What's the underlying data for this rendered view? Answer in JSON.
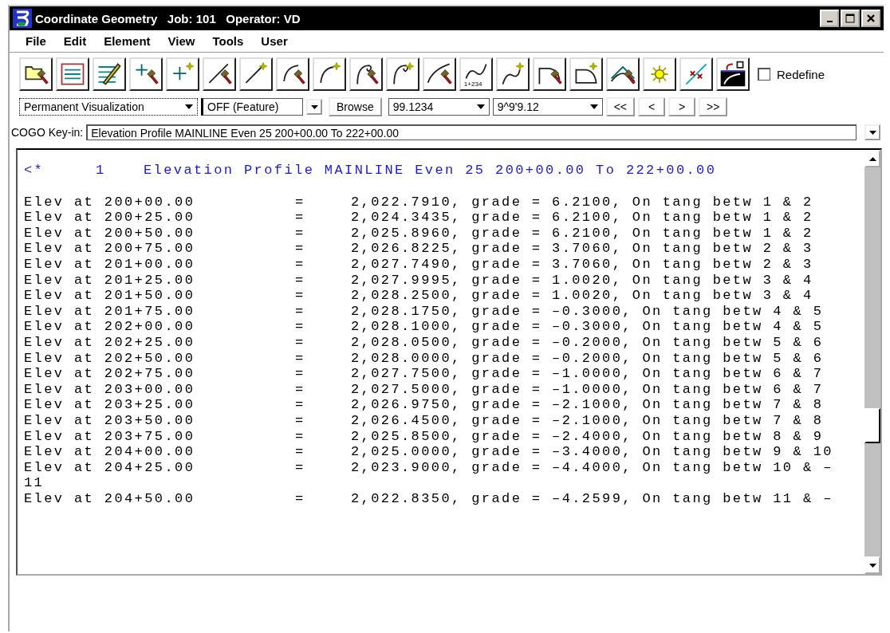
{
  "window": {
    "title": "Coordinate Geometry   Job: 101   Operator: VD"
  },
  "menu": [
    "File",
    "Edit",
    "Element",
    "View",
    "Tools",
    "User"
  ],
  "toolbar": {
    "icon_caption": "1+234",
    "redefine": {
      "label": "Redefine",
      "checked": false
    }
  },
  "controls": {
    "visualization": "Permanent Visualization",
    "feature": "OFF (Feature)",
    "browse": "Browse",
    "distance": "99.1234",
    "angle": "9^9'9.12",
    "nav": [
      "<<",
      "<",
      ">",
      ">>"
    ]
  },
  "keyin": {
    "label": "COGO Key-in:",
    "value": "Elevation Profile MAINLINE Even 25 200+00.00 To 222+00.00"
  },
  "output": {
    "header": {
      "marker": "<*",
      "number": "1",
      "text": "Elevation Profile MAINLINE Even 25 200+00.00 To 222+00.00"
    },
    "lines": [
      {
        "kind": "row",
        "station": "Elev at 200+00.00",
        "eq": "=",
        "result": "2,022.7910, grade = 6.2100, On tang betw 1 & 2"
      },
      {
        "kind": "row",
        "station": "Elev at 200+25.00",
        "eq": "=",
        "result": "2,024.3435, grade = 6.2100, On tang betw 1 & 2"
      },
      {
        "kind": "row",
        "station": "Elev at 200+50.00",
        "eq": "=",
        "result": "2,025.8960, grade = 6.2100, On tang betw 1 & 2"
      },
      {
        "kind": "row",
        "station": "Elev at 200+75.00",
        "eq": "=",
        "result": "2,026.8225, grade = 3.7060, On tang betw 2 & 3"
      },
      {
        "kind": "row",
        "station": "Elev at 201+00.00",
        "eq": "=",
        "result": "2,027.7490, grade = 3.7060, On tang betw 2 & 3"
      },
      {
        "kind": "row",
        "station": "Elev at 201+25.00",
        "eq": "=",
        "result": "2,027.9995, grade = 1.0020, On tang betw 3 & 4"
      },
      {
        "kind": "row",
        "station": "Elev at 201+50.00",
        "eq": "=",
        "result": "2,028.2500, grade = 1.0020, On tang betw 3 & 4"
      },
      {
        "kind": "row",
        "station": "Elev at 201+75.00",
        "eq": "=",
        "result": "2,028.1750, grade = –0.3000, On tang betw 4 & 5"
      },
      {
        "kind": "row",
        "station": "Elev at 202+00.00",
        "eq": "=",
        "result": "2,028.1000, grade = –0.3000, On tang betw 4 & 5"
      },
      {
        "kind": "row",
        "station": "Elev at 202+25.00",
        "eq": "=",
        "result": "2,028.0500, grade = –0.2000, On tang betw 5 & 6"
      },
      {
        "kind": "row",
        "station": "Elev at 202+50.00",
        "eq": "=",
        "result": "2,028.0000, grade = –0.2000, On tang betw 5 & 6"
      },
      {
        "kind": "row",
        "station": "Elev at 202+75.00",
        "eq": "=",
        "result": "2,027.7500, grade = –1.0000, On tang betw 6 & 7"
      },
      {
        "kind": "row",
        "station": "Elev at 203+00.00",
        "eq": "=",
        "result": "2,027.5000, grade = –1.0000, On tang betw 6 & 7"
      },
      {
        "kind": "row",
        "station": "Elev at 203+25.00",
        "eq": "=",
        "result": "2,026.9750, grade = –2.1000, On tang betw 7 & 8"
      },
      {
        "kind": "row",
        "station": "Elev at 203+50.00",
        "eq": "=",
        "result": "2,026.4500, grade = –2.1000, On tang betw 7 & 8"
      },
      {
        "kind": "row",
        "station": "Elev at 203+75.00",
        "eq": "=",
        "result": "2,025.8500, grade = –2.4000, On tang betw 8 & 9"
      },
      {
        "kind": "row",
        "station": "Elev at 204+00.00",
        "eq": "=",
        "result": "2,025.0000, grade = –3.4000, On tang betw 9 & 10"
      },
      {
        "kind": "row",
        "station": "Elev at 204+25.00",
        "eq": "=",
        "result": "2,023.9000, grade = –4.4000, On tang betw 10 & –"
      },
      {
        "kind": "wrap",
        "text": "11"
      },
      {
        "kind": "row",
        "station": "Elev at 204+50.00",
        "eq": "=",
        "result": "2,022.8350, grade = –4.2599, On tang betw 11 & –"
      }
    ]
  }
}
